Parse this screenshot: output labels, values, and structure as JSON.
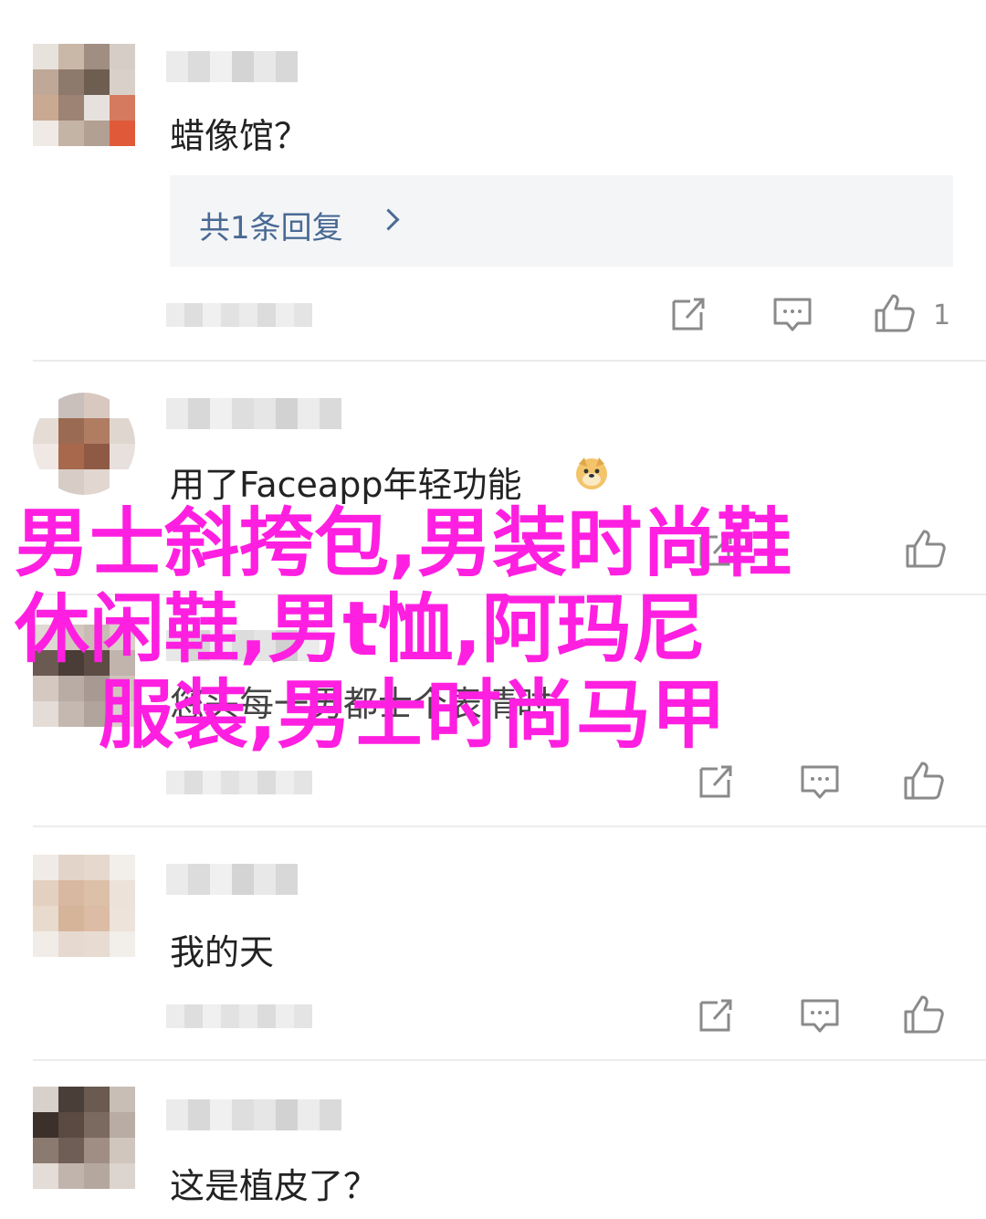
{
  "comments": [
    {
      "text": "蜡像馆？",
      "reply_label": "共1条回复",
      "like_count": "1",
      "avatar_colors": [
        "#e8e2dc",
        "#c9b8a8",
        "#a08e82",
        "#d6cec6",
        "#bfa898",
        "#8d7a6c",
        "#6e5e52",
        "#d9d1c9",
        "#caa992",
        "#9c8374",
        "#e6e1dc",
        "#d67a5f",
        "#efeae6",
        "#c4b4a6",
        "#b2a092",
        "#e05a3a"
      ]
    },
    {
      "text": "用了Faceapp年轻功能",
      "like_count": "",
      "avatar_colors": [
        "#ffffff",
        "#c9c0bb",
        "#d9c8c0",
        "#ffffff",
        "#e6dcd6",
        "#9a6a52",
        "#b07c62",
        "#e0d6d0",
        "#efe8e4",
        "#a8684c",
        "#8e5a44",
        "#e8e0dc",
        "#ffffff",
        "#d8ccc6",
        "#e2d6d0",
        "#ffffff"
      ]
    },
    {
      "text": "您头每一男都士个表情时",
      "like_count": "",
      "avatar_colors": [
        "#e0d8d2",
        "#d2c6be",
        "#c8bcb4",
        "#d9cfc8",
        "#6a5a52",
        "#4a3c36",
        "#5c4c44",
        "#c0b4ac",
        "#d4c8c0",
        "#b8aca4",
        "#a89a92",
        "#d0c4bc",
        "#e4dcd6",
        "#c4b8b0",
        "#b0a49c",
        "#d8d0ca"
      ]
    },
    {
      "text": "我的天",
      "like_count": "",
      "avatar_colors": [
        "#f0ebe7",
        "#e2d4c8",
        "#e6d8cc",
        "#f2eeea",
        "#e4d0c0",
        "#d8b8a0",
        "#dcc0a8",
        "#ece2da",
        "#e8dacd",
        "#d6b49a",
        "#dcbca4",
        "#ede3da",
        "#f1ece8",
        "#e6dad0",
        "#e8dcd2",
        "#f2eeea"
      ]
    },
    {
      "text": "这是植皮了？",
      "like_count": "",
      "avatar_colors": [
        "#d8d0ca",
        "#4a3e38",
        "#6a5a50",
        "#c8beb6",
        "#3c302a",
        "#5a4a42",
        "#7a6a60",
        "#b8aca4",
        "#8a7a70",
        "#6e5e56",
        "#a08e84",
        "#d0c6be",
        "#e4dcd6",
        "#c0b4ac",
        "#b4a89e",
        "#dcd4ce"
      ]
    }
  ],
  "overlay": {
    "lines": [
      "男士斜挎包,男装时尚鞋",
      "休闲鞋,男t恤,阿玛尼",
      "服装,男士时尚马甲"
    ],
    "color": "#ff1fe0"
  },
  "icons": {
    "share": "share-icon",
    "comment": "comment-icon",
    "like": "thumbs-up-icon",
    "reply_arrow": "chevron-right-icon",
    "emoji": "doge-emoji-icon"
  },
  "colors": {
    "reply_link": "#4a6a94",
    "reply_bg": "#f4f5f7",
    "icon_gray": "#8a8a8a"
  }
}
